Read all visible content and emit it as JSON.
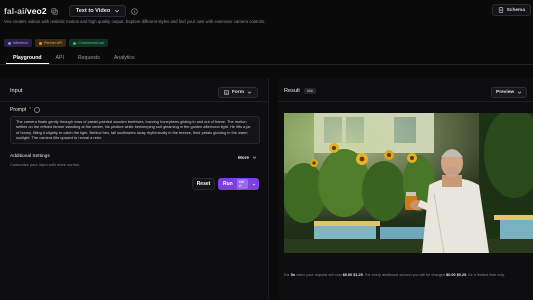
{
  "app": {
    "org": "fal-ai/",
    "model": "veo2",
    "mode": "Text to Video",
    "schema_label": "Schema",
    "description": "Veo creates videos with realistic motion and high quality output. Explore different styles and find your own with extensive camera controls."
  },
  "badges": [
    {
      "label": "Inference",
      "icon": "bolt-icon"
    },
    {
      "label": "Partner API",
      "icon": "link-icon"
    },
    {
      "label": "Commercial use",
      "icon": "check-icon"
    }
  ],
  "tabs": [
    {
      "label": "Playground",
      "active": true
    },
    {
      "label": "API",
      "active": false
    },
    {
      "label": "Requests",
      "active": false
    },
    {
      "label": "Analytics",
      "active": false
    }
  ],
  "input": {
    "title": "Input",
    "form_label": "Form",
    "prompt_label": "Prompt",
    "prompt_value": "The camera floats gently through rows of pastel-painted wooden beehives, buzzing honeybees gliding in and out of frame. The motion settles on the refined farmer standing at the center, his pristine white beekeeping suit gleaming in the golden afternoon light. He lifts a jar of honey, tilting it slightly to catch the light. Behind him, tall sunflowers sway rhythmically in the breeze, their petals glowing in the warm sunlight. The camera tilts upward to reveal a retro",
    "advanced_title": "Additional Settings",
    "advanced_subtitle": "Customize your input with more control.",
    "more_label": "More",
    "reset_label": "Reset",
    "run_label": "Run",
    "run_shortcut": "ctrl ↵"
  },
  "result": {
    "title": "Result",
    "status": "Idle",
    "preview_label": "Preview"
  },
  "cost": {
    "lead": "For ",
    "duration": "5s",
    "mid": " video your request will cost ",
    "price1": "$0.00 $1.25",
    "mid2": ". For every additional second you will be charged ",
    "price2": "$0.00 $0.25",
    "tail": ", for a limited time only."
  },
  "colors": {
    "accent": "#7b3fe4",
    "background": "#0a0a0b",
    "panel": "#0e0e10"
  }
}
